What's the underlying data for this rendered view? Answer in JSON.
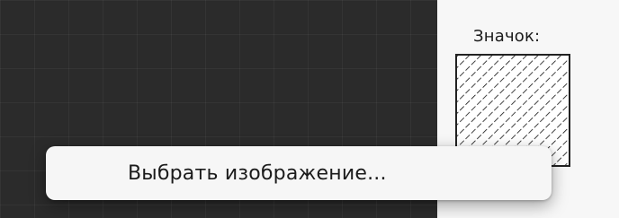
{
  "properties_panel": {
    "icon_label": "Значок:",
    "icon_preview": "hatched-placeholder-image"
  },
  "context_menu": {
    "items": [
      {
        "label": "Выбрать изображение..."
      }
    ]
  },
  "colors": {
    "canvas_background": "#2b2b2b",
    "panel_background": "#f7f7f7",
    "menu_background": "#f6f6f6",
    "text": "#1b1b1b"
  }
}
